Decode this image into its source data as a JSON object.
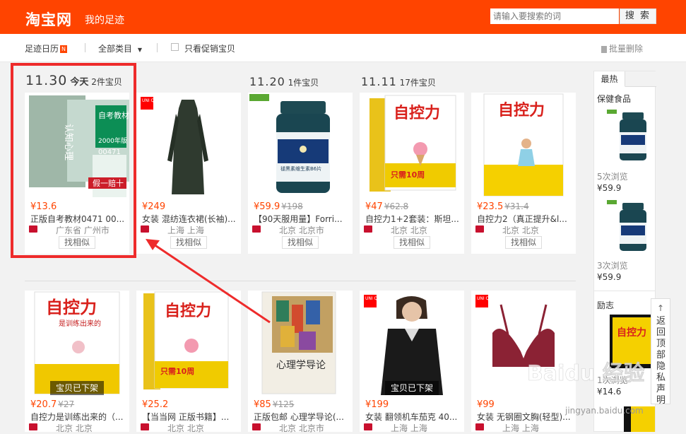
{
  "header": {
    "logo": "淘宝网",
    "subtitle": "我的足迹",
    "search_placeholder": "请输入要搜索的词",
    "search_button": "搜 索"
  },
  "toolbar": {
    "calendar_label": "足迹日历",
    "calendar_badge": "N",
    "category_label": "全部类目",
    "promo_label": "只看促销宝贝",
    "batch_delete": "批量删除"
  },
  "groups": [
    {
      "day": "11.30",
      "today": "今天",
      "count": "2件宝贝"
    },
    {
      "day": "11.20",
      "today": "",
      "count": "1件宝贝"
    },
    {
      "day": "11.11",
      "today": "",
      "count": "17件宝贝"
    }
  ],
  "row1": [
    {
      "price": "¥13.6",
      "old_price": "",
      "title": "正版自考教材0471 00...",
      "location": "广东省 广州市",
      "similar": "找相似",
      "offline": ""
    },
    {
      "price": "¥249",
      "old_price": "",
      "title": "女装 混纺连衣裙(长袖)...",
      "location": "上海 上海",
      "similar": "找相似",
      "offline": ""
    },
    {
      "price": "¥59.9",
      "old_price": "¥198",
      "title": "【90天服用量】Forri...",
      "location": "北京 北京市",
      "similar": "找相似",
      "offline": ""
    },
    {
      "price": "¥47",
      "old_price": "¥62.8",
      "title": "自控力1+2套装：斯坦...",
      "location": "北京 北京",
      "similar": "找相似",
      "offline": ""
    },
    {
      "price": "¥23.5",
      "old_price": "¥31.4",
      "title": "自控力2（真正提升&l...",
      "location": "北京 北京",
      "similar": "找相似",
      "offline": ""
    }
  ],
  "row2": [
    {
      "price": "¥20.7",
      "old_price": "¥27",
      "title": "自控力是训练出来的（...",
      "location": "北京 北京",
      "offline": "宝贝已下架"
    },
    {
      "price": "¥25.2",
      "old_price": "",
      "title": "【当当网 正版书籍】...",
      "location": "北京 北京",
      "offline": ""
    },
    {
      "price": "¥85",
      "old_price": "¥125",
      "title": "正版包邮 心理学导论(...",
      "location": "北京 北京市",
      "offline": ""
    },
    {
      "price": "¥199",
      "old_price": "",
      "title": "女装 翻领机车茄克 40...",
      "location": "上海 上海",
      "offline": "宝贝已下架"
    },
    {
      "price": "¥99",
      "old_price": "",
      "title": "女装 无钢圈文胸(轻型)...",
      "location": "上海 上海",
      "offline": ""
    }
  ],
  "book_texts": {
    "zkl": "自控力",
    "zkl2": "自控力",
    "zkl_sub": "是训练出来的",
    "xl": "心理学导论",
    "rz": "认知心理",
    "zk": "自考教材",
    "code": "00471",
    "year": "2000年版",
    "fake": "假一赔十",
    "vitamin": "褪黑素维生素B6片",
    "uniqlo": "UNI QLO",
    "save": "只需10周"
  },
  "sidebar": {
    "tab": "最热",
    "cat1": "保健食品",
    "item1_views": "5次浏览",
    "item1_price": "¥59.9",
    "item2_views": "3次浏览",
    "item2_price": "¥59.9",
    "cat2": "励志",
    "item3_views": "1次浏览",
    "item3_price": "¥14.6"
  },
  "backtop": {
    "arrow": "↑",
    "label": "返回顶部隐私声明"
  },
  "watermark": {
    "brand": "Baidu 经验",
    "url": "jingyan.baidu.com"
  },
  "colors": {
    "accent": "#ff4400",
    "highlight": "#ee2b2b"
  }
}
